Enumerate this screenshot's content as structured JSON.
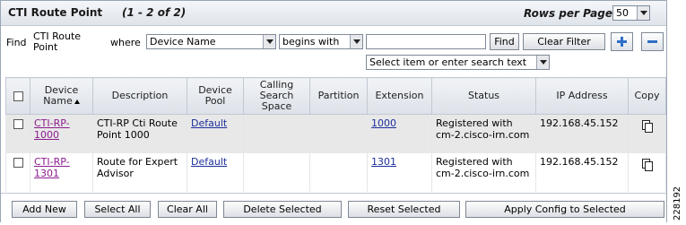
{
  "header": {
    "title": "CTI Route Point",
    "count": "(1 - 2 of 2)",
    "rows_per_page_label": "Rows per Page",
    "rows_per_page_value": "50"
  },
  "search": {
    "find_label": "Find",
    "object_label": "CTI Route Point",
    "where_label": "where",
    "field_value": "Device Name",
    "operator_value": "begins with",
    "input_value": "",
    "find_button": "Find",
    "clear_filter_button": "Clear Filter",
    "hint_value": "Select item or enter search text"
  },
  "table": {
    "columns": {
      "device_name": "Device Name",
      "description": "Description",
      "device_pool": "Device Pool",
      "calling_search_space": "Calling Search Space",
      "partition": "Partition",
      "extension": "Extension",
      "status": "Status",
      "ip_address": "IP Address",
      "copy": "Copy"
    },
    "rows": [
      {
        "device_name": "CTI-RP-1000",
        "description": "CTI-RP Cti Route Point 1000",
        "device_pool": "Default",
        "calling_search_space": "",
        "partition": "",
        "extension": "1000",
        "status": "Registered with cm-2.cisco-irn.com",
        "ip_address": "192.168.45.152"
      },
      {
        "device_name": "CTI-RP-1301",
        "description": "Route for Expert Advisor",
        "device_pool": "Default",
        "calling_search_space": "",
        "partition": "",
        "extension": "1301",
        "status": "Registered with cm-2.cisco-irn.com",
        "ip_address": "192.168.45.152"
      }
    ]
  },
  "footer": {
    "add_new": "Add New",
    "select_all": "Select All",
    "clear_all": "Clear All",
    "delete_selected": "Delete Selected",
    "reset_selected": "Reset Selected",
    "apply_config": "Apply Config to Selected"
  },
  "figure_id": "228192",
  "icons": {
    "add": "plus-icon",
    "remove": "minus-icon",
    "copy": "copy-icon",
    "sort": "sort-ascending-icon"
  },
  "colors": {
    "link": "#1c2f9a",
    "visited_link": "#8b1b8e",
    "header_gradient_top": "#f4f6f9",
    "row_alt": "#e8e8e8",
    "filter_icon": "#2e6fc6"
  }
}
